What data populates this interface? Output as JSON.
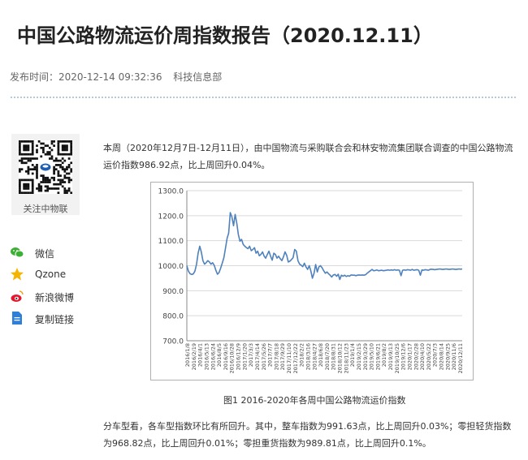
{
  "header": {
    "title": "中国公路物流运价周指数报告（2020.12.11）",
    "publish_label": "发布时间：",
    "publish_time": "2020-12-14 09:32:36",
    "department": "科技信息部"
  },
  "sidebar": {
    "qr_label": "关注中物联",
    "share": [
      {
        "label": "微信",
        "icon": "wechat-icon",
        "color": "#3cb034"
      },
      {
        "label": "Qzone",
        "icon": "star-icon",
        "color": "#f4b400"
      },
      {
        "label": "新浪微博",
        "icon": "weibo-icon",
        "color": "#e6162d"
      },
      {
        "label": "复制链接",
        "icon": "document-icon",
        "color": "#2d7fd8"
      }
    ]
  },
  "article": {
    "paragraph1": "本周（2020年12月7日-12月11日），由中国物流与采购联合会和林安物流集团联合调查的中国公路物流运价指数986.92点，比上周回升0.04%。",
    "caption": "图1 2016-2020年各周中国公路物流运价指数",
    "paragraph2": "分车型看，各车型指数环比有所回升。其中，整车指数为991.63点，比上周回升0.03%；零担轻货指数为968.82点，比上周回升0.01%；零担重货指数为989.81点，比上周回升0.1%。"
  },
  "chart_data": {
    "type": "line",
    "title": "",
    "xlabel": "",
    "ylabel": "",
    "ylim": [
      700,
      1300
    ],
    "yticks": [
      "1300.0",
      "1200.0",
      "1100.0",
      "1000.0",
      "900.0",
      "800.0",
      "700.0"
    ],
    "grid": true,
    "line_color": "#4f81bd",
    "series": [
      {
        "values": [
          1000,
          978,
          968,
          965,
          967,
          978,
          1005,
          1050,
          1078,
          1055,
          1020,
          1006,
          1012,
          1020,
          1015,
          1006,
          1012,
          1002,
          982,
          966,
          972,
          990,
          1010,
          1032,
          1070,
          1110,
          1130,
          1212,
          1195,
          1160,
          1205,
          1170,
          1125,
          1098,
          1105,
          1085,
          1078,
          1072,
          1068,
          1078,
          1060,
          1065,
          1072,
          1050,
          1058,
          1040,
          1045,
          1055,
          1038,
          1030,
          1045,
          1058,
          1038,
          1022,
          1050,
          1045,
          1030,
          1038,
          1028,
          1020,
          1035,
          1055,
          1042,
          1015,
          1018,
          1025,
          1032,
          1065,
          1058,
          1020,
          1006,
          1002,
          996,
          1010,
          995,
          985,
          1000,
          980,
          950,
          970,
          1005,
          975,
          995,
          1000,
          992,
          980,
          970,
          975,
          968,
          962,
          955,
          963,
          965,
          958,
          966,
          945,
          962,
          958,
          962,
          957,
          960,
          958,
          963,
          962,
          962,
          960,
          962,
          963,
          962,
          963,
          962,
          964,
          970,
          975,
          980,
          985,
          980,
          981,
          983,
          980,
          981,
          982,
          980,
          981,
          982,
          983,
          982,
          983,
          982,
          984,
          982,
          983,
          982,
          960,
          982,
          983,
          982,
          984,
          983,
          982,
          985,
          982,
          983,
          984,
          982,
          962,
          983,
          982,
          984,
          983,
          982,
          985,
          986,
          985,
          984,
          985,
          986,
          987,
          986,
          985,
          986,
          987,
          986,
          985,
          986,
          987,
          986,
          985,
          986,
          987,
          986,
          987
        ]
      }
    ],
    "x_tick_labels": [
      "2016/1/8",
      "2016/2/19",
      "2016/4/1",
      "2016/5/13",
      "2016/6/24",
      "2016/8/5",
      "2016/9/16",
      "2016/10/28",
      "2016/12/9",
      "2017/1/20",
      "2017/3/3",
      "2017/4/14",
      "2017/5/26",
      "2017/7/7",
      "2017/8/18",
      "2017/9/29",
      "2017/11/10",
      "2017/12/22",
      "2018/2/2",
      "2018/3/16",
      "2018/4/27",
      "2018/6/8",
      "2018/7/20",
      "2018/8/31",
      "2018/10/12",
      "2018/11/23",
      "2019/1/4",
      "2019/2/15",
      "2019/3/29",
      "2019/5/10",
      "2019/6/21",
      "2019/8/2",
      "2019/9/13",
      "2019/10/25",
      "2019/12/6",
      "2020/1/17",
      "2020/2/28",
      "2020/4/10",
      "2020/5/22",
      "2020/7/3",
      "2020/8/14",
      "2020/9/25",
      "2020/11/6",
      "2020/12/11"
    ]
  }
}
